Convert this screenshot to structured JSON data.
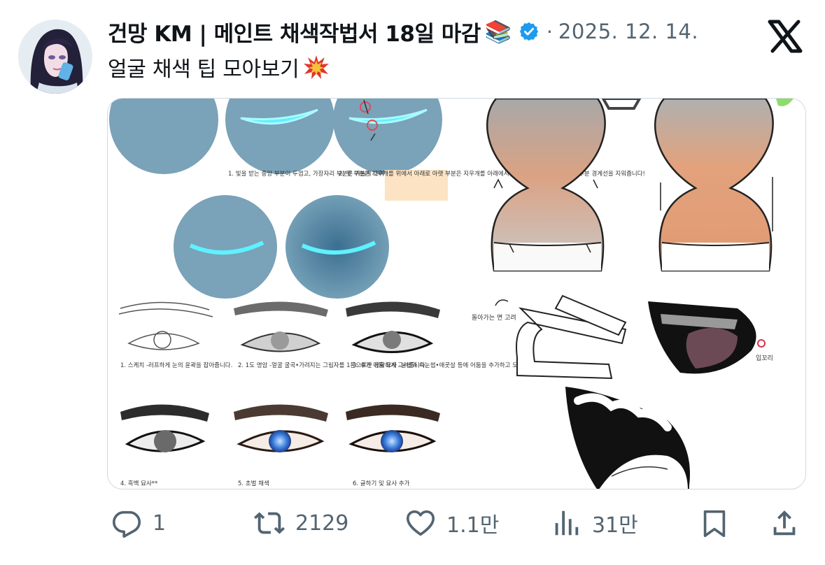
{
  "author": {
    "display_name": "건망 KM | 메인트 채색작법서 18일 마감",
    "name_emoji": "📚",
    "verified": true,
    "separator": "·",
    "date": "2025. 12. 14."
  },
  "tweet": {
    "text": "얼굴 채색 팁 모아보기",
    "text_emoji": "💥"
  },
  "media": {
    "steps_blue": [
      "1. 빛을 받는 중앙 부분이 두껍고, 가장자리 부분은 가늘게 그려줍니다.",
      "2. 윗 부분은 지우개를 위에서 아래로 아랫 부분은 지우개를 아래에서 위로 머리카락 섹션 나뉘는 부분 경계선을 지워줍니다!"
    ],
    "steps_eye_top": [
      "1. 스케치 -러프하게 눈의 윤곽을 잡아줍니다.",
      "2. 1도 명암 -얼굴 굴곡•가려지는 그림자를 1톤으로만 정확하게 그려줍니다.",
      "3. 추가 어둠 묘사 -눈썹과 속눈썹•애굣살 등에 어둠을 추가하고 모양을 다듬습니다."
    ],
    "steps_eye_bottom": [
      "4. 흑백 묘사**",
      "5. 초벌 채색",
      "6. 글하기 및 묘사 추가"
    ],
    "label_turn": "돌아가는 면 고려",
    "label_corner": "입꼬리"
  },
  "actions": {
    "replies": "1",
    "retweets": "2129",
    "likes": "1.1만",
    "views": "31만"
  },
  "colors": {
    "text": "#0f1419",
    "secondary": "#536471",
    "verified_blue": "#1d9bf0",
    "border": "#cfd9de"
  }
}
